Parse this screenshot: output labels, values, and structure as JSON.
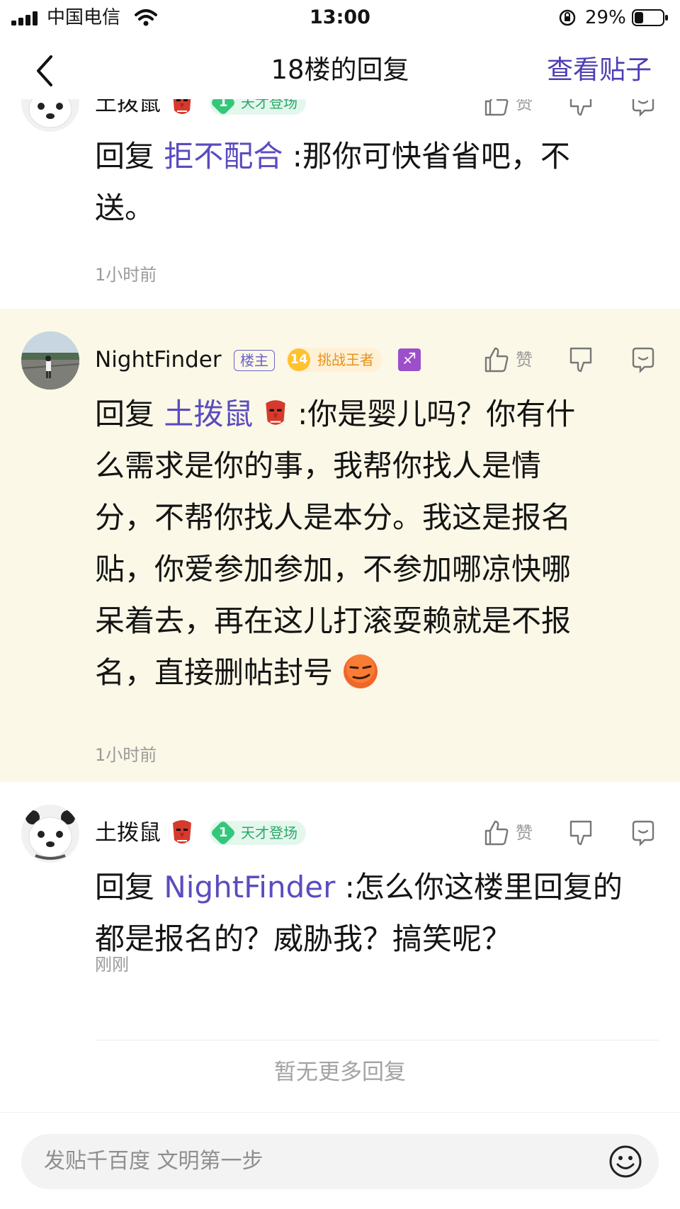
{
  "status_bar": {
    "carrier": "中国电信",
    "time": "13:00",
    "battery_percent": "29%"
  },
  "nav": {
    "title": "18楼的回复",
    "right_action": "查看贴子"
  },
  "replies": [
    {
      "username": "土拨鼠",
      "level": "1",
      "level_title": "天才登场",
      "like_label": "赞",
      "reply_prefix": "回复",
      "mention": "拒不配合",
      "text_line1": ":那你可快省省吧，不",
      "text_line2": "送。",
      "time": "1小时前"
    },
    {
      "username": "NightFinder",
      "owner_badge": "楼主",
      "level": "14",
      "level_title": "挑战王者",
      "like_label": "赞",
      "reply_prefix": "回复",
      "mention": "土拨鼠",
      "lines": [
        ":你是婴儿吗？你有什",
        "么需求是你的事，我帮你找人是情",
        "分，不帮你找人是本分。我这是报名",
        "贴，你爱参加参加，不参加哪凉快哪",
        "呆着去，再在这儿打滚耍赖就是不报",
        "名，直接删帖封号"
      ],
      "time": "1小时前"
    },
    {
      "username": "土拨鼠",
      "level": "1",
      "level_title": "天才登场",
      "like_label": "赞",
      "reply_prefix": "回复",
      "mention": "NightFinder",
      "text_line1": ":怎么你这楼里回复的",
      "text_line2": "都是报名的？威胁我？搞笑呢？",
      "time": "刚刚"
    }
  ],
  "footer_note": "暂无更多回复",
  "composer": {
    "placeholder": "发贴千百度 文明第一步"
  },
  "colors": {
    "accent": "#4d3fb5",
    "mention": "#5a4cc0",
    "highlight_bg": "#fbf8e7",
    "meta_gray": "#9a9a9a"
  }
}
